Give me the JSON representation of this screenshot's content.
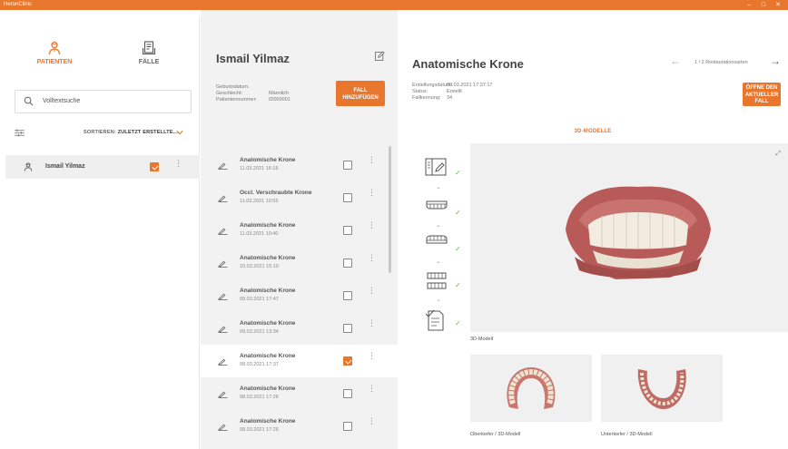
{
  "window": {
    "title": "HeronClinic",
    "minimize": "–",
    "maximize": "□",
    "close": "✕"
  },
  "nav": {
    "tabs": [
      {
        "label": "PATIENTEN",
        "icon": "patient-icon",
        "active": true
      },
      {
        "label": "FÄLLE",
        "icon": "cases-icon",
        "active": false
      }
    ]
  },
  "search": {
    "placeholder": "Volltextsuche"
  },
  "sort": {
    "prefix": "SORTIEREN:",
    "value": "ZULETZT ERSTELLTE..."
  },
  "patients": [
    {
      "name": "Ismail Yilmaz",
      "checked": true
    }
  ],
  "patient": {
    "name": "Ismail Yilmaz",
    "fields": [
      {
        "key": "Geburtsdatum:",
        "value": ""
      },
      {
        "key": "Geschlecht:",
        "value": "Männlich"
      },
      {
        "key": "Patientennummer:",
        "value": "ID000001"
      }
    ],
    "add_case_label": "FALL HINZUFÜGEN"
  },
  "cases": [
    {
      "title": "Anatomische Krone",
      "date": "11.03.2021 16:18",
      "checked": false,
      "selected": false
    },
    {
      "title": "Occl. Verschraubte Krone",
      "date": "11.03.2021 10:55",
      "checked": false,
      "selected": false
    },
    {
      "title": "Anatomische Krone",
      "date": "11.03.2021 10:40",
      "checked": false,
      "selected": false
    },
    {
      "title": "Anatomische Krone",
      "date": "10.03.2021 15:10",
      "checked": false,
      "selected": false
    },
    {
      "title": "Anatomische Krone",
      "date": "09.03.2021 17:47",
      "checked": false,
      "selected": false
    },
    {
      "title": "Anatomische Krone",
      "date": "09.03.2021 13:34",
      "checked": false,
      "selected": false
    },
    {
      "title": "Anatomische Krone",
      "date": "08.03.2021 17:37",
      "checked": true,
      "selected": true
    },
    {
      "title": "Anatomische Krone",
      "date": "08.03.2021 17:26",
      "checked": false,
      "selected": false
    },
    {
      "title": "Anatomische Krone",
      "date": "08.03.2021 17:26",
      "checked": false,
      "selected": false
    }
  ],
  "case_detail": {
    "title": "Anatomische Krone",
    "pager": "1 / 2 Restaurationsarten",
    "fields": [
      {
        "key": "Erstellungsdatum:",
        "value": "08.03.2021 17:37:17"
      },
      {
        "key": "Status:",
        "value": "Erstellt"
      },
      {
        "key": "Fallkennung:",
        "value": "34"
      }
    ],
    "open_case_label": "ÖFFNE DEN AKTUELLER FALL",
    "section_title": "3D-MODELLE",
    "model_caption": "3D-Modell",
    "thumbs": [
      {
        "caption": "Oberkiefer / 3D-Modell"
      },
      {
        "caption": "Unterkiefer / 3D-Modell"
      }
    ]
  },
  "colors": {
    "accent": "#e8762c",
    "check": "#6aba45",
    "panel": "#f2f2f2"
  }
}
